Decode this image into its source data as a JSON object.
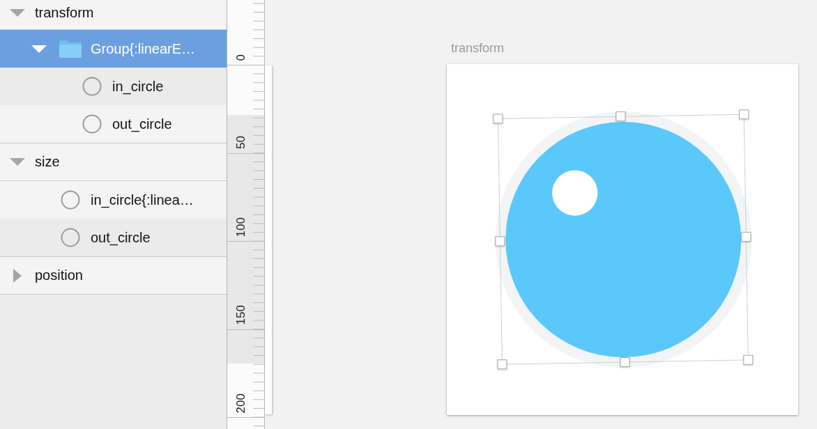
{
  "layers_panel": {
    "items": [
      {
        "label": "transform",
        "expanded": true,
        "selected": false,
        "children": [
          {
            "label": "Group{:linearE…",
            "kind": "folder",
            "expanded": true,
            "selected": true,
            "children": [
              {
                "label": "in_circle",
                "kind": "shape",
                "selected": false
              },
              {
                "label": "out_circle",
                "kind": "shape",
                "selected": false
              }
            ]
          }
        ]
      },
      {
        "label": "size",
        "expanded": true,
        "selected": false,
        "children": [
          {
            "label": "in_circle{:linea…",
            "kind": "shape",
            "selected": false
          },
          {
            "label": "out_circle",
            "kind": "shape",
            "selected": false
          }
        ]
      },
      {
        "label": "position",
        "expanded": false,
        "selected": false
      }
    ]
  },
  "ruler": {
    "labels": [
      "0",
      "50",
      "100",
      "150",
      "200"
    ]
  },
  "canvas": {
    "artboard": {
      "title": "transform"
    }
  }
}
